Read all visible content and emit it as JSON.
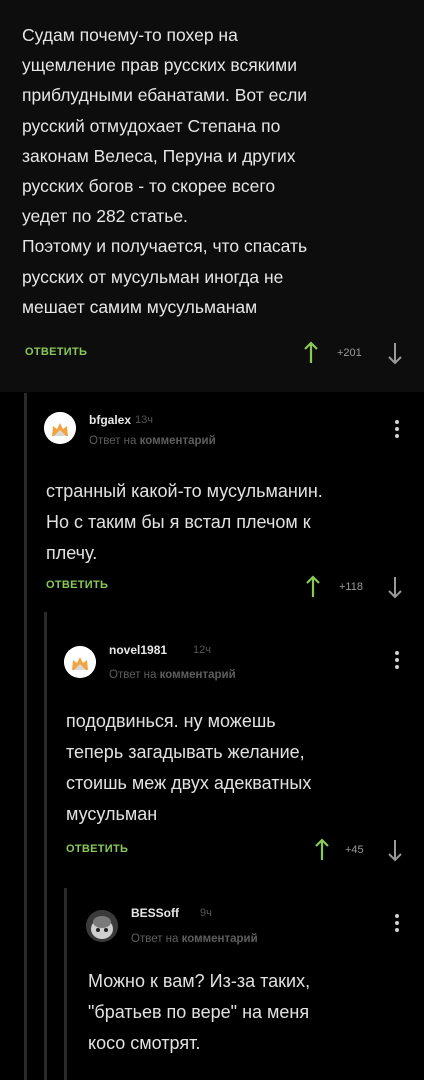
{
  "root_comment": {
    "text": "Судам почему-то похер на\nущемление прав русских всякими\nприблудными ебанатами. Вот если\nрусский отмудохает Степана по\nзаконам Велеса, Перуна и других\nрусских богов - то скорее всего\nуедет по 282 статье.\nПоэтому и  получается, что спасать\nрусских от мусульман иногда не\nмешает самим мусульманам",
    "reply_label": "ОТВЕТИТЬ",
    "rating": "+201"
  },
  "replies": [
    {
      "author": "bfgalex",
      "time": "13ч",
      "reply_prefix": "Ответ на",
      "reply_target": "комментарий",
      "text": "странный какой-то мусульманин.\nНо с таким бы я встал плечом к\nплечу.",
      "reply_label": "ОТВЕТИТЬ",
      "rating": "+118"
    },
    {
      "author": "novel1981",
      "time": "12ч",
      "reply_prefix": "Ответ на",
      "reply_target": "комментарий",
      "text": "пододвинься. ну можешь\nтеперь загадывать желание,\nстоишь меж двух адекватных\nмусульман",
      "reply_label": "ОТВЕТИТЬ",
      "rating": "+45"
    },
    {
      "author": "BESSoff",
      "time": "9ч",
      "reply_prefix": "Ответ на",
      "reply_target": "комментарий",
      "text": "Можно к вам? Из-за таких,\n\"братьев по вере\" на меня\nкосо смотрят."
    }
  ],
  "colors": {
    "accent_green": "#8ac858",
    "background": "#000000",
    "root_background": "#0d0d0d"
  },
  "icons": {
    "upvote": "arrow-up-icon",
    "downvote": "arrow-down-icon",
    "menu": "kebab-menu-icon",
    "avatar_default": "default-avatar-icon"
  }
}
